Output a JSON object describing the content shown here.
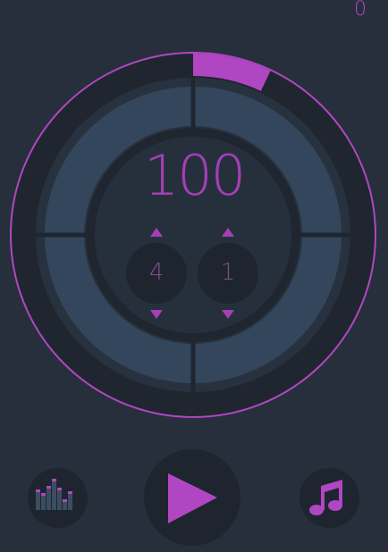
{
  "header": {
    "counter": "0"
  },
  "tempo": {
    "bpm": "100"
  },
  "time_signature": {
    "beats": "4",
    "subdivision": "1"
  },
  "beat_progress": 0.07,
  "colors": {
    "accent": "#b146c2",
    "background": "#262f3b",
    "segment": "#34465b",
    "ring": "#1e252f"
  },
  "controls": {
    "left_icon": "equalizer-icon",
    "center_icon": "play-icon",
    "right_icon": "music-note-icon"
  }
}
